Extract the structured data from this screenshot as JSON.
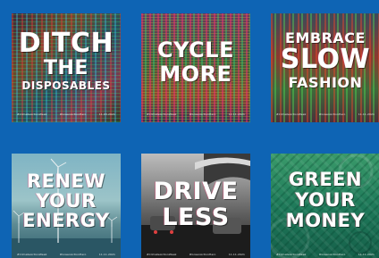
{
  "background_color": "#0e64b4",
  "tiles": [
    {
      "id": "ditch-the-disposables",
      "lines": [
        "DITCH",
        "THE",
        "DISPOSABLES"
      ],
      "footer": [
        "#ClimateActionWeek",
        "#GreenActionHero",
        "11.03.2021"
      ],
      "image": "glitched-plastic-waste-photo"
    },
    {
      "id": "cycle-more",
      "lines": [
        "CYCLE",
        "MORE"
      ],
      "footer": [
        "#ClimateActionWeek",
        "#GreenActionHero",
        "11.11.2021"
      ],
      "image": "glitched-bicycles-photo"
    },
    {
      "id": "embrace-slow-fashion",
      "lines": [
        "EMBRACE",
        "SLOW",
        "FASHION"
      ],
      "footer": [
        "#ClimateActionWeek",
        "#GreenActionHero",
        "11.11.2021"
      ],
      "image": "glitched-clothing-rack-photo"
    },
    {
      "id": "renew-your-energy",
      "lines": [
        "RENEW",
        "YOUR",
        "ENERGY"
      ],
      "footer": [
        "#ClimateActionWeek",
        "#GreenActionHero",
        "11.11.2021"
      ],
      "image": "offshore-wind-turbines-photo"
    },
    {
      "id": "drive-less",
      "lines": [
        "DRIVE",
        "LESS"
      ],
      "footer": [
        "#ClimateActionWeek",
        "#GreenActionHero",
        "11.11.2021"
      ],
      "image": "traffic-under-overpass-photo"
    },
    {
      "id": "green-your-money",
      "lines": [
        "GREEN",
        "YOUR",
        "MONEY"
      ],
      "footer": [
        "#ClimateActionWeek",
        "#GreenActionHero",
        "11.11.2021"
      ],
      "image": "green-banknote-pattern"
    }
  ]
}
